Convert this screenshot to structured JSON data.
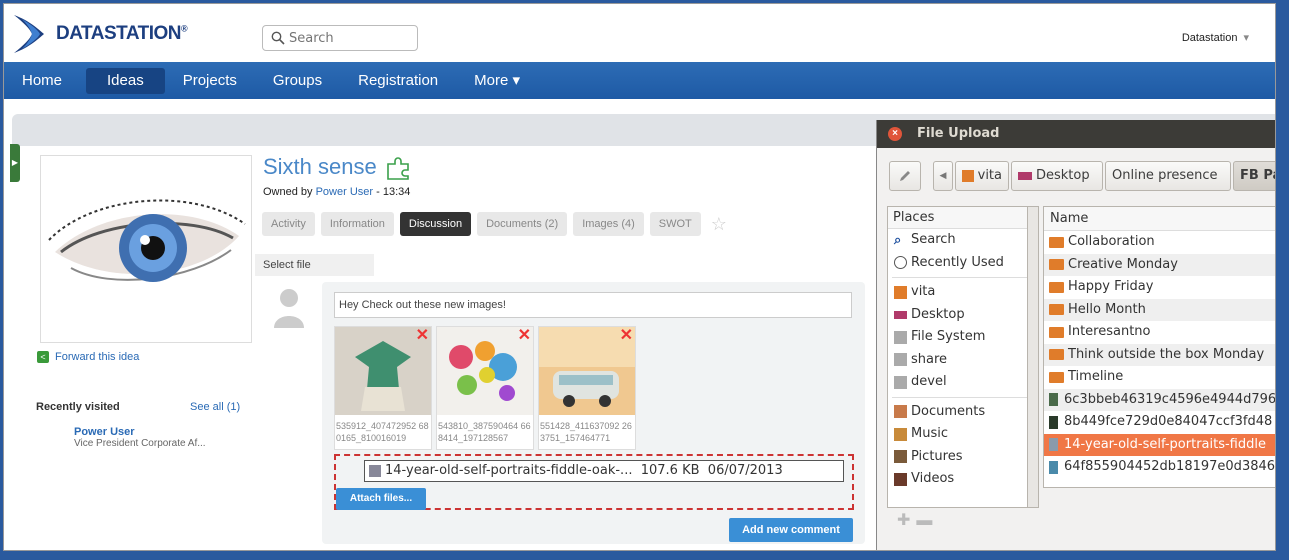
{
  "header": {
    "logo_text": "DATASTATION",
    "logo_mark": "®",
    "search_placeholder": "Search",
    "user_name": "Datastation",
    "user_caret": "▾"
  },
  "nav": {
    "items": [
      {
        "label": "Home",
        "active": false
      },
      {
        "label": "Ideas",
        "active": true
      },
      {
        "label": "Projects",
        "active": false
      },
      {
        "label": "Groups",
        "active": false
      },
      {
        "label": "Registration",
        "active": false
      },
      {
        "label": "More ▾",
        "active": false
      }
    ]
  },
  "idea": {
    "title": "Sixth sense",
    "owned_prefix": "Owned by",
    "owner": "Power User",
    "owned_time": "- 13:34",
    "forward_label": "Forward this idea",
    "tabs": [
      {
        "label": "Activity",
        "active": false
      },
      {
        "label": "Information",
        "active": false
      },
      {
        "label": "Discussion",
        "active": true
      },
      {
        "label": "Documents (2)",
        "active": false
      },
      {
        "label": "Images (4)",
        "active": false
      },
      {
        "label": "SWOT",
        "active": false
      }
    ],
    "select_file_label": "Select file"
  },
  "recent": {
    "title": "Recently visited",
    "see_all": "See all (1)",
    "name": "Power User",
    "role": "Vice President Corporate Af..."
  },
  "comment": {
    "input_value": "Hey Check out these new images!",
    "thumbnails": [
      {
        "caption": "535912_407472952 680165_810016019"
      },
      {
        "caption": "543810_387590464 668414_197128567"
      },
      {
        "caption": "551428_411637092 263751_157464771"
      }
    ],
    "dragged_file": {
      "name": "14-year-old-self-portraits-fiddle-oak-...",
      "size": "107.6 KB",
      "date": "06/07/2013"
    },
    "attach_label": "Attach files...",
    "add_comment_label": "Add new comment"
  },
  "dialog": {
    "title": "File Upload",
    "path_buttons": [
      "vita",
      "Desktop",
      "Online presence",
      "FB Pa"
    ],
    "places_header": "Places",
    "places": [
      "Search",
      "Recently Used",
      "vita",
      "Desktop",
      "File System",
      "share",
      "devel",
      "Documents",
      "Music",
      "Pictures",
      "Videos"
    ],
    "name_header": "Name",
    "files": [
      {
        "name": "Collaboration",
        "type": "folder"
      },
      {
        "name": "Creative Monday",
        "type": "folder"
      },
      {
        "name": "Happy Friday",
        "type": "folder"
      },
      {
        "name": "Hello Month",
        "type": "folder"
      },
      {
        "name": "Interesantno",
        "type": "folder"
      },
      {
        "name": "Think outside the box Monday",
        "type": "folder"
      },
      {
        "name": "Timeline",
        "type": "folder"
      },
      {
        "name": "6c3bbeb46319c4596e4944d796",
        "type": "file"
      },
      {
        "name": "8b449fce729d0e84047ccf3fd48",
        "type": "file"
      },
      {
        "name": "14-year-old-self-portraits-fiddle",
        "type": "file",
        "selected": true
      },
      {
        "name": "64f855904452db18197e0d3846",
        "type": "file"
      }
    ]
  },
  "colors": {
    "brand": "#1d3f80",
    "nav": "#2a6ab5",
    "accent": "#3a8fd6",
    "selection": "#f07746",
    "drop_border": "#cc3333"
  }
}
